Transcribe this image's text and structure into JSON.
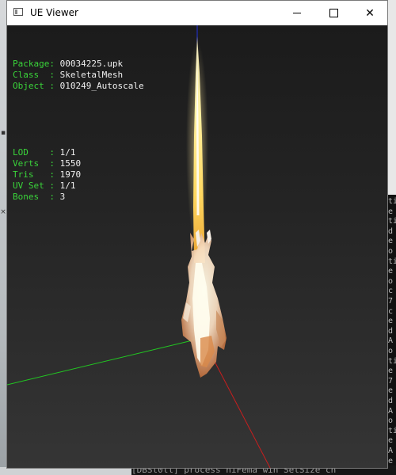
{
  "window": {
    "title": "UE Viewer",
    "minimize_glyph": "",
    "close_glyph": "✕"
  },
  "info": {
    "group1": [
      {
        "key": "Package: ",
        "value": "00034225.upk"
      },
      {
        "key": "Class  : ",
        "value": "SkeletalMesh"
      },
      {
        "key": "Object : ",
        "value": "010249_Autoscale"
      }
    ],
    "group2": [
      {
        "key": "LOD    : ",
        "value": "1/1"
      },
      {
        "key": "Verts  : ",
        "value": "1550"
      },
      {
        "key": "Tris   : ",
        "value": "1970"
      },
      {
        "key": "UV Set : ",
        "value": "1/1"
      },
      {
        "key": "Bones  : ",
        "value": "3"
      }
    ]
  },
  "colors": {
    "info_key": "#3ad43a",
    "info_value": "#f0f0f0",
    "axis_x": "#c81e1e",
    "axis_y": "#22c622",
    "axis_z": "#2030e0"
  },
  "background": {
    "console_bottom_text": "[DBSt0ll] process  niFema win SetSize  ch",
    "console_side_lines": [
      "ti",
      "e",
      "ti",
      "d",
      "e",
      "o",
      "ti",
      "e",
      "o",
      "c",
      "7",
      "c",
      "e",
      "d",
      "A",
      "o",
      "ti",
      "e",
      "7",
      "e",
      "d",
      "A",
      "o",
      "ti",
      "e",
      "A",
      "e"
    ]
  }
}
